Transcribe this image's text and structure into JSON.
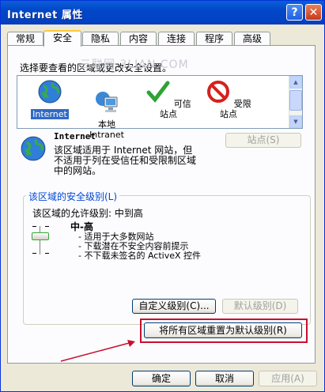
{
  "window": {
    "title": "Internet 属性",
    "help_glyph": "?",
    "close_glyph": "✕"
  },
  "tabs": [
    "常规",
    "安全",
    "隐私",
    "内容",
    "连接",
    "程序",
    "高级"
  ],
  "active_tab": "安全",
  "security": {
    "instruction": "选择要查看的区域或更改安全设置。",
    "watermark": "三联网 3LIAN.COM",
    "zones": [
      {
        "label": "Internet",
        "icon": "globe-icon"
      },
      {
        "label": "本地\nIntranet",
        "icon": "network-computer-icon"
      },
      {
        "label": "可信站点",
        "icon": "checkmark-icon"
      },
      {
        "label": "受限站点",
        "icon": "no-entry-icon"
      }
    ],
    "selected_zone": "Internet",
    "zone_heading": "Internet",
    "zone_description_lines": [
      "该区域适用于 Internet 网站，但",
      "不适用于列在受信任和受限制区域",
      "中的网站。"
    ],
    "sites_button": "站点(S)",
    "level_group_title": "该区域的安全级别(L)",
    "allowed_level": "该区域的允许级别: 中到高",
    "level_name": "中-高",
    "level_bullets": [
      "- 适用于大多数网站",
      "- 下载潜在不安全内容前提示",
      "- 不下载未签名的 ActiveX 控件"
    ],
    "custom_level_button": "自定义级别(C)...",
    "default_level_button": "默认级别(D)",
    "reset_all_button": "将所有区域重置为默认级别(R)"
  },
  "footer": {
    "ok": "确定",
    "cancel": "取消",
    "apply": "应用(A)"
  },
  "colors": {
    "titlebar": "#0247c9",
    "selection": "#316ac5",
    "highlight_frame": "#c8102e",
    "annotation_arrow": "#c8102e"
  }
}
